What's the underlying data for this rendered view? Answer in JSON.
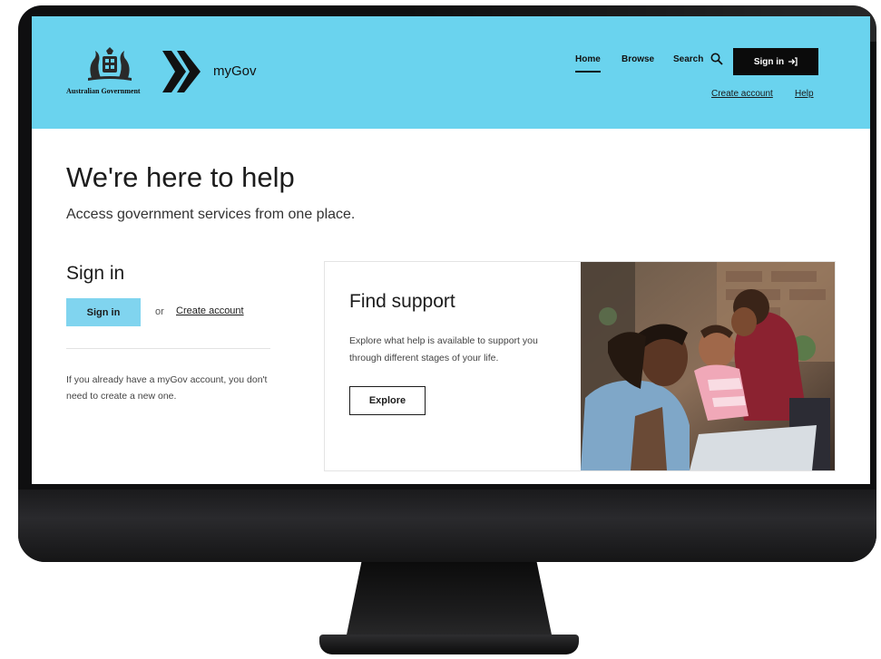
{
  "header": {
    "gov_name": "Australian Government",
    "brand": "myGov",
    "nav": {
      "home": "Home",
      "browse": "Browse",
      "search": "Search"
    },
    "sign_in": "Sign in",
    "create_account": "Create account",
    "help": "Help"
  },
  "hero": {
    "title": "We're here to help",
    "subtitle": "Access government services from one place."
  },
  "signin": {
    "heading": "Sign in",
    "button": "Sign in",
    "or": "or",
    "create_account": "Create account",
    "note": "If you already have a myGov account, you don't need to create a new one."
  },
  "support": {
    "title": "Find support",
    "text": "Explore what help is available to support you through different stages of your life.",
    "button": "Explore"
  },
  "colors": {
    "header_bg": "#6ad3ee",
    "signin_button": "#80d4ef",
    "dark": "#0b0b0b"
  }
}
